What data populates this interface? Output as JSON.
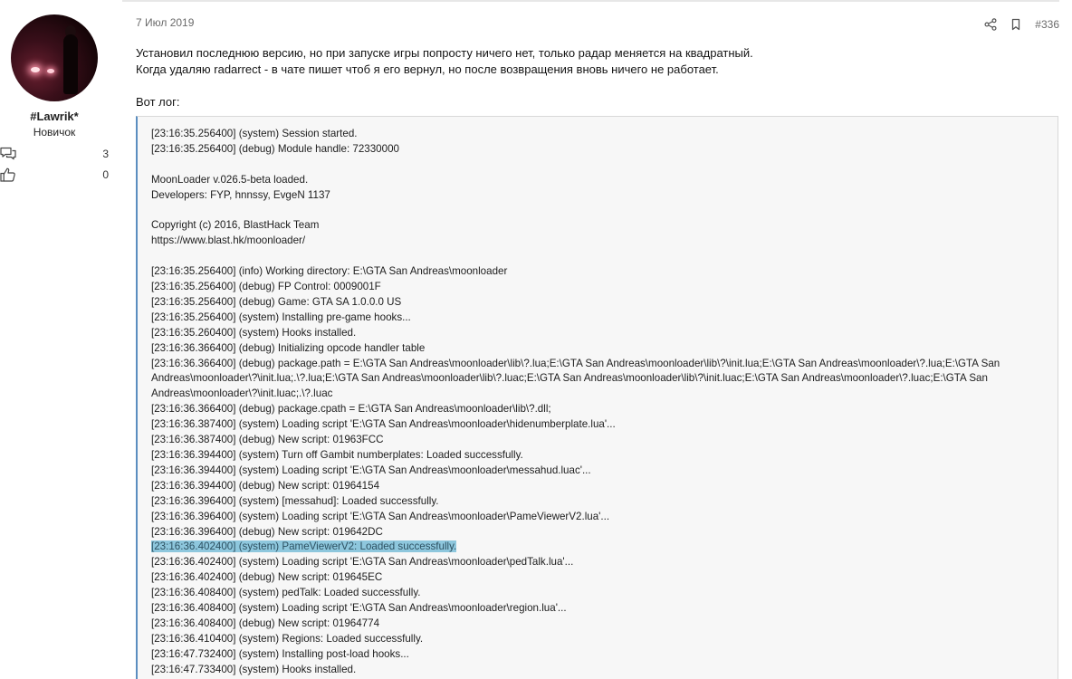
{
  "user": {
    "name": "#Lawrik*",
    "title": "Новичок",
    "stats": [
      {
        "icon": "messages-icon",
        "value": "3"
      },
      {
        "icon": "likes-icon",
        "value": "0"
      }
    ]
  },
  "post": {
    "date": "7 Июл 2019",
    "number": "#336",
    "action_icons": [
      "share-icon",
      "bookmark-icon"
    ],
    "body_lines": [
      "Установил последнюю версию, но при запуске игры попросту ничего нет, только радар меняется на квадратный.",
      "Когда удаляю radarrect - в чате пишет чтоб я его вернул, но после возвращения вновь ничего не работает."
    ],
    "log_label": "Вот лог:"
  },
  "log": {
    "selected_index": 25,
    "lines": [
      "[23:16:35.256400] (system) Session started.",
      "[23:16:35.256400] (debug) Module handle: 72330000",
      "",
      "MoonLoader v.026.5-beta loaded.",
      "Developers: FYP, hnnssy, EvgeN 1137",
      "",
      "Copyright (c) 2016, BlastHack Team",
      "https://www.blast.hk/moonloader/",
      "",
      "[23:16:35.256400] (info) Working directory: E:\\GTA San Andreas\\moonloader",
      "[23:16:35.256400] (debug) FP Control: 0009001F",
      "[23:16:35.256400] (debug) Game: GTA SA 1.0.0.0 US",
      "[23:16:35.256400] (system) Installing pre-game hooks...",
      "[23:16:35.260400] (system) Hooks installed.",
      "[23:16:36.366400] (debug) Initializing opcode handler table",
      "[23:16:36.366400] (debug) package.path = E:\\GTA San Andreas\\moonloader\\lib\\?.lua;E:\\GTA San Andreas\\moonloader\\lib\\?\\init.lua;E:\\GTA San Andreas\\moonloader\\?.lua;E:\\GTA San Andreas\\moonloader\\?\\init.lua;.\\?.lua;E:\\GTA San Andreas\\moonloader\\lib\\?.luac;E:\\GTA San Andreas\\moonloader\\lib\\?\\init.luac;E:\\GTA San Andreas\\moonloader\\?.luac;E:\\GTA San Andreas\\moonloader\\?\\init.luac;.\\?.luac",
      "[23:16:36.366400] (debug) package.cpath = E:\\GTA San Andreas\\moonloader\\lib\\?.dll;",
      "[23:16:36.387400] (system) Loading script 'E:\\GTA San Andreas\\moonloader\\hidenumberplate.lua'...",
      "[23:16:36.387400] (debug) New script: 01963FCC",
      "[23:16:36.394400] (system) Turn off Gambit numberplates: Loaded successfully.",
      "[23:16:36.394400] (system) Loading script 'E:\\GTA San Andreas\\moonloader\\messahud.luac'...",
      "[23:16:36.394400] (debug) New script: 01964154",
      "[23:16:36.396400] (system) [messahud]: Loaded successfully.",
      "[23:16:36.396400] (system) Loading script 'E:\\GTA San Andreas\\moonloader\\PameViewerV2.lua'...",
      "[23:16:36.396400] (debug) New script: 019642DC",
      "[23:16:36.402400] (system) PameViewerV2: Loaded successfully.",
      "[23:16:36.402400] (system) Loading script 'E:\\GTA San Andreas\\moonloader\\pedTalk.lua'...",
      "[23:16:36.402400] (debug) New script: 019645EC",
      "[23:16:36.408400] (system) pedTalk: Loaded successfully.",
      "[23:16:36.408400] (system) Loading script 'E:\\GTA San Andreas\\moonloader\\region.lua'...",
      "[23:16:36.408400] (debug) New script: 01964774",
      "[23:16:36.410400] (system) Regions: Loaded successfully.",
      "[23:16:47.732400] (system) Installing post-load hooks...",
      "[23:16:47.733400] (system) Hooks installed."
    ]
  }
}
